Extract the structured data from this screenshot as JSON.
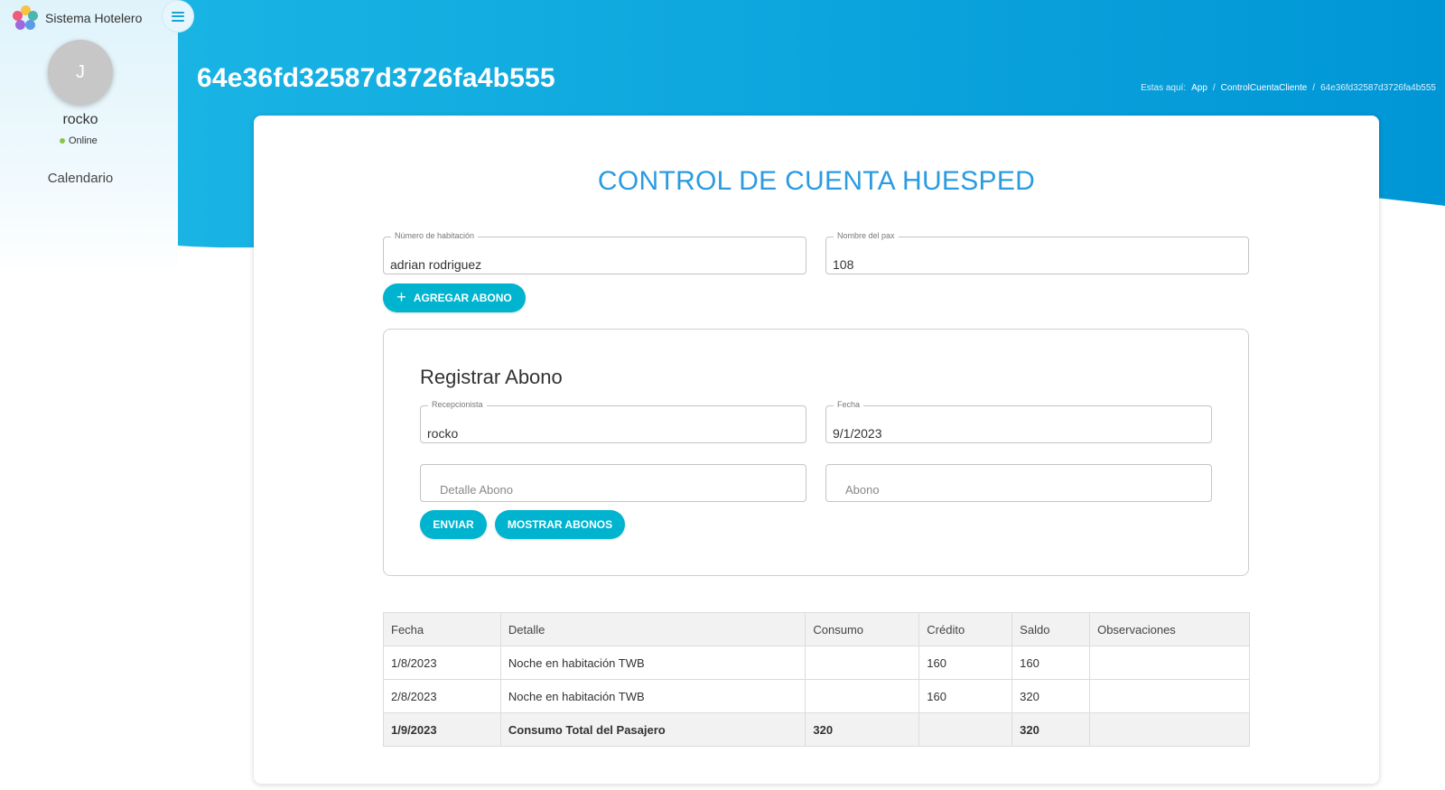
{
  "app": {
    "name": "Sistema Hotelero"
  },
  "user": {
    "initial": "J",
    "name": "rocko",
    "status": "Online"
  },
  "nav": {
    "items": [
      {
        "label": "Calendario"
      }
    ]
  },
  "header": {
    "title": "64e36fd32587d3726fa4b555",
    "breadcrumb": {
      "prefix": "Estas aquí:",
      "items": [
        "App",
        "ControlCuentaCliente",
        "64e36fd32587d3726fa4b555"
      ],
      "separator": "/"
    }
  },
  "card": {
    "heading": "CONTROL DE CUENTA HUESPED",
    "fields": {
      "room": {
        "label": "Número de habitación",
        "value": "adrian rodriguez"
      },
      "pax": {
        "label": "Nombre del pax",
        "value": "108"
      }
    },
    "add_button": {
      "icon": "plus-icon",
      "label": "AGREGAR ABONO"
    }
  },
  "abono_form": {
    "title": "Registrar Abono",
    "receptionist": {
      "label": "Recepcionista",
      "value": "rocko"
    },
    "date": {
      "label": "Fecha",
      "value": "9/1/2023"
    },
    "detail": {
      "placeholder": "Detalle Abono"
    },
    "amount": {
      "placeholder": "Abono"
    },
    "send_label": "ENVIAR",
    "show_label": "MOSTRAR ABONOS"
  },
  "ledger": {
    "columns": [
      "Fecha",
      "Detalle",
      "Consumo",
      "Crédito",
      "Saldo",
      "Observaciones"
    ],
    "rows": [
      [
        "1/8/2023",
        "Noche en habitación TWB",
        "",
        "160",
        "160",
        ""
      ],
      [
        "2/8/2023",
        "Noche en habitación TWB",
        "",
        "160",
        "320",
        ""
      ]
    ],
    "total": [
      "1/9/2023",
      "Consumo Total del Pasajero",
      "320",
      "",
      "320",
      ""
    ]
  },
  "colors": {
    "header_gradient_start": "#19b4e4",
    "header_gradient_end": "#0096d6",
    "accent_button": "#00b4d0",
    "heading": "#2b9be0"
  }
}
